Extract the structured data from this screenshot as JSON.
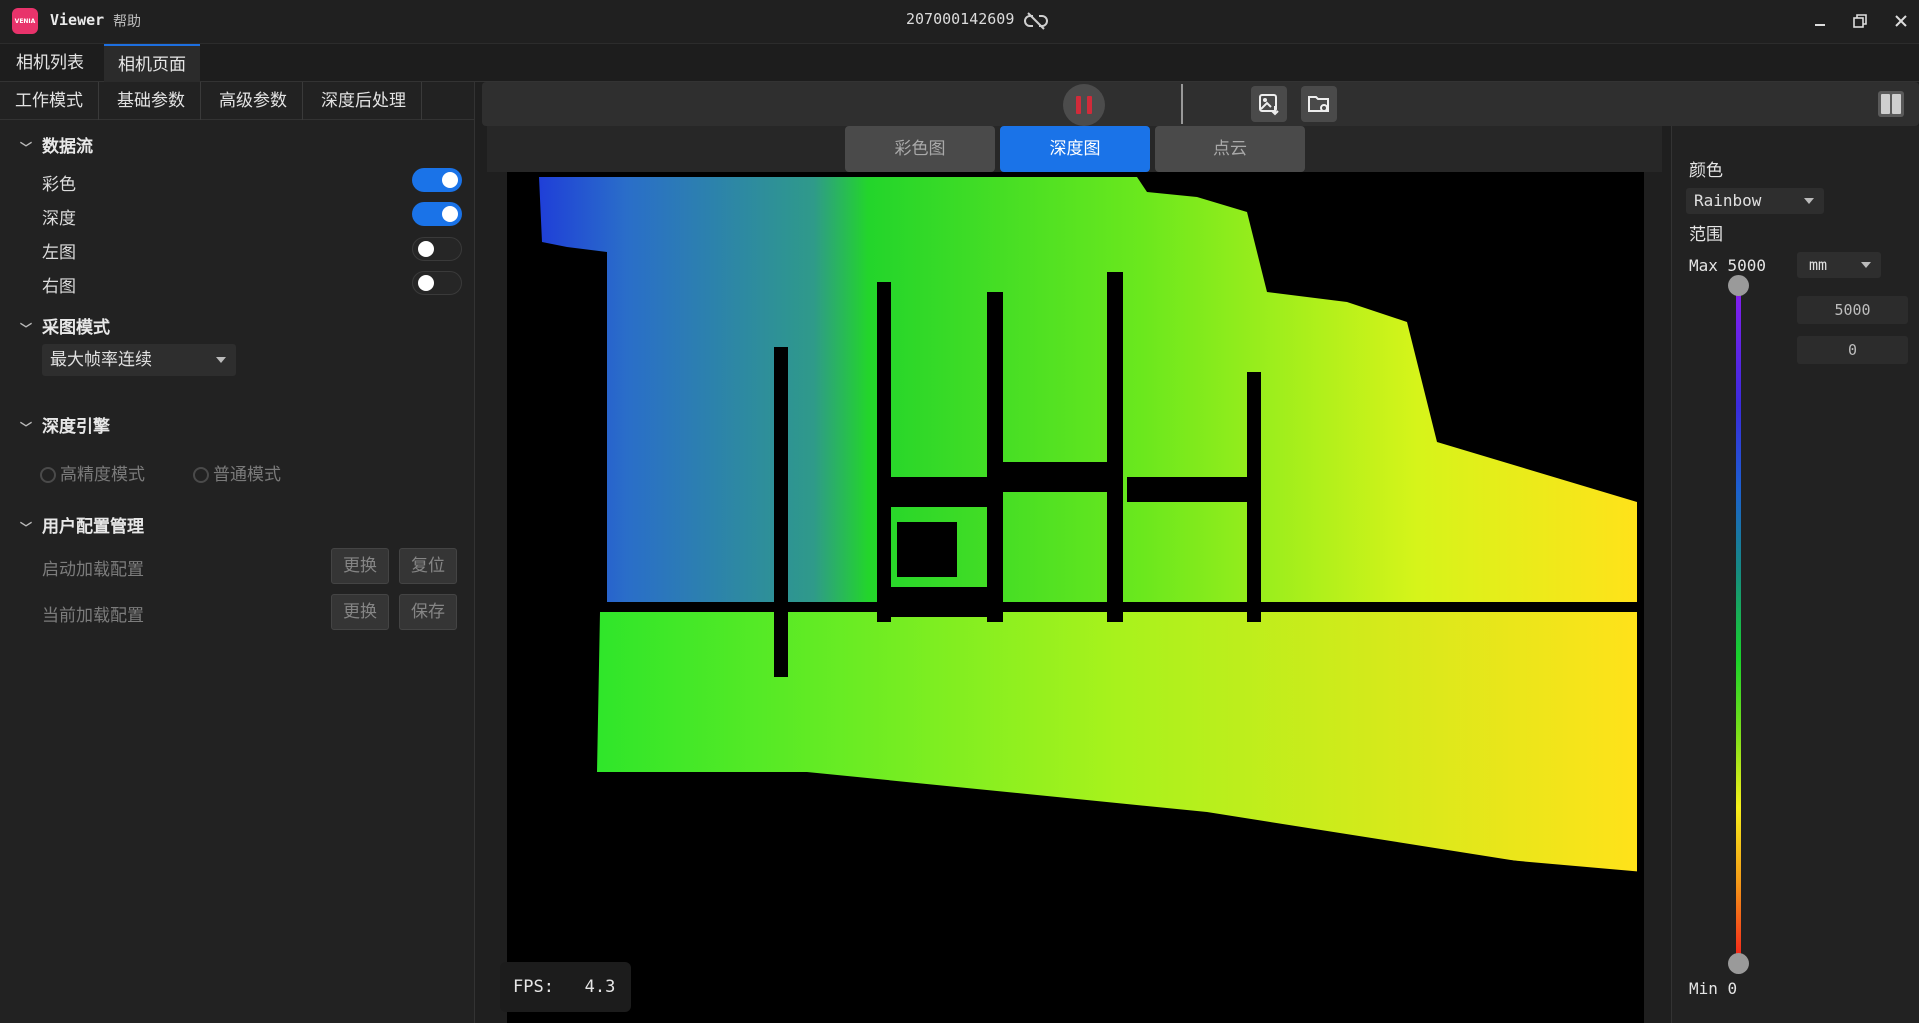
{
  "titlebar": {
    "logo_text": "VENIA",
    "app_title": "Viewer",
    "help": "帮助",
    "serial": "207000142609"
  },
  "page_tabs": [
    "相机列表",
    "相机页面"
  ],
  "left_panel": {
    "subtabs": [
      "工作模式",
      "基础参数",
      "高级参数",
      "深度后处理"
    ],
    "data_stream": {
      "title": "数据流",
      "items": [
        {
          "label": "彩色",
          "on": true
        },
        {
          "label": "深度",
          "on": true
        },
        {
          "label": "左图",
          "on": false
        },
        {
          "label": "右图",
          "on": false
        }
      ]
    },
    "capture_mode": {
      "title": "采图模式",
      "selected": "最大帧率连续"
    },
    "depth_engine": {
      "title": "深度引擎",
      "options": [
        "高精度模式",
        "普通模式"
      ]
    },
    "user_config": {
      "title": "用户配置管理",
      "rows": [
        {
          "label": "启动加载配置",
          "buttons": [
            "更换",
            "复位"
          ]
        },
        {
          "label": "当前加载配置",
          "buttons": [
            "更换",
            "保存"
          ]
        }
      ]
    }
  },
  "view_tabs": [
    "彩色图",
    "深度图",
    "点云"
  ],
  "active_view": "深度图",
  "fps": {
    "label": "FPS:",
    "value": "4.3"
  },
  "right_panel": {
    "color_label": "颜色",
    "colormap": "Rainbow",
    "range_label": "范围",
    "max_label": "Max 5000",
    "unit": "mm",
    "max_value": "5000",
    "min_value": "0",
    "min_label": "Min 0"
  },
  "icons": [
    "link-broken-icon",
    "minimize-icon",
    "restore-icon",
    "close-icon",
    "pause-icon",
    "save-image-icon",
    "folder-settings-icon",
    "panel-toggle-icon",
    "chevron-down-icon"
  ]
}
